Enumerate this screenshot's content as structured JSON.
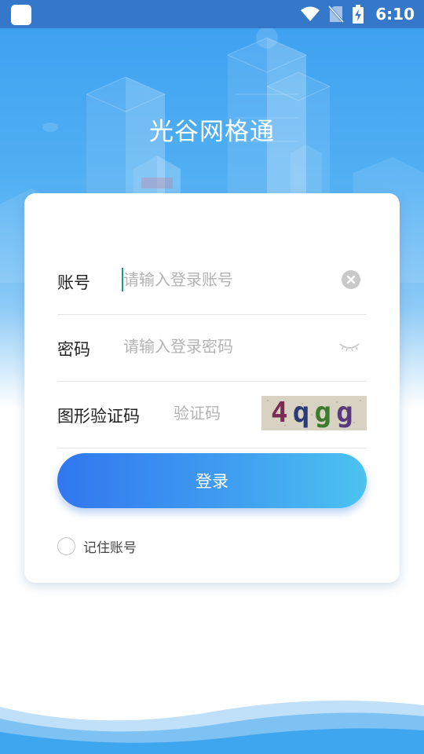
{
  "status_bar": {
    "time": "6:10",
    "icons": [
      "app-icon",
      "wifi-icon",
      "no-sim-icon",
      "battery-charging-icon"
    ]
  },
  "app": {
    "title": "光谷网格通"
  },
  "form": {
    "account": {
      "label": "账号",
      "placeholder": "请输入登录账号",
      "value": ""
    },
    "password": {
      "label": "密码",
      "placeholder": "请输入登录密码",
      "value": ""
    },
    "captcha": {
      "label": "图形验证码",
      "placeholder": "验证码",
      "value": "",
      "image_text": "4qgg"
    },
    "login_button": "登录",
    "remember": {
      "label": "记住账号",
      "checked": false
    }
  },
  "colors": {
    "status_bar": "#3578c9",
    "hero_top": "#3b9ff0",
    "button_start": "#3177ef",
    "button_end": "#4cc3f1",
    "caret": "#1a9b8f"
  }
}
